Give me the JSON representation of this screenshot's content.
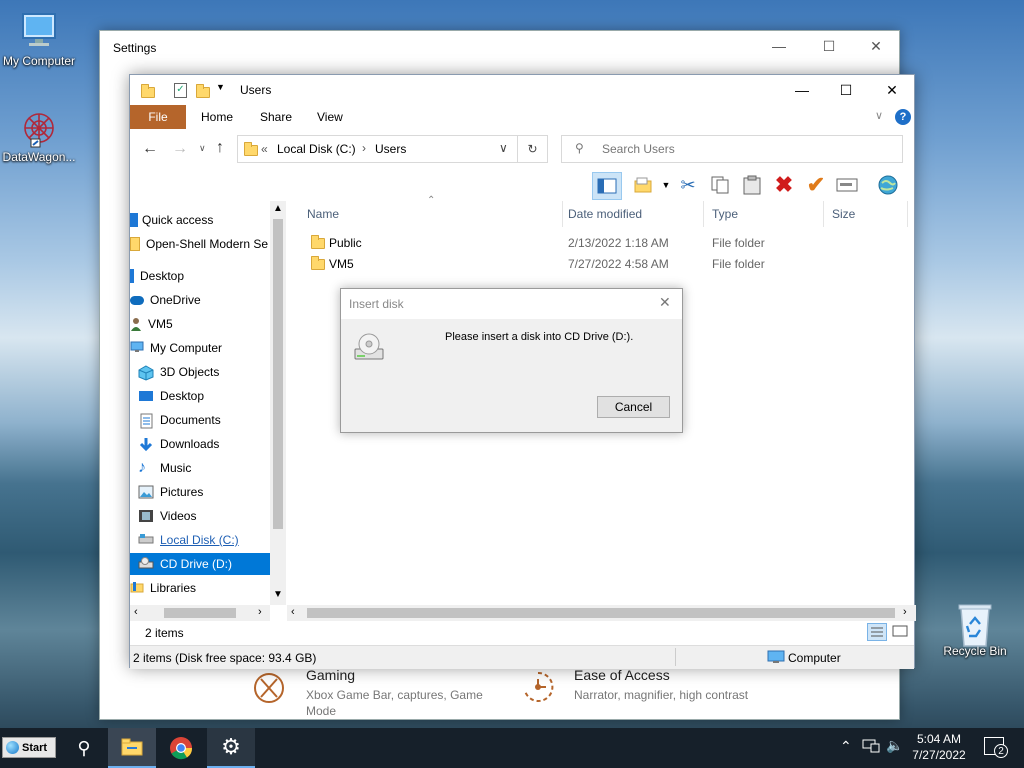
{
  "desktop": {
    "icons": [
      {
        "label": "My Computer",
        "icon": "monitor-icon"
      },
      {
        "label": "DataWagon...",
        "icon": "datawagon-icon"
      },
      {
        "label": "Recycle Bin",
        "icon": "recycle-bin-icon"
      }
    ]
  },
  "settings": {
    "title": "Settings",
    "categories": [
      {
        "title": "Gaming",
        "desc": "Xbox Game Bar, captures, Game Mode",
        "icon": "xbox-icon"
      },
      {
        "title": "Ease of Access",
        "desc": "Narrator, magnifier, high contrast",
        "icon": "ease-of-access-icon"
      }
    ]
  },
  "explorer": {
    "title": "Users",
    "tabs": {
      "file": "File",
      "home": "Home",
      "share": "Share",
      "view": "View"
    },
    "address": {
      "prefix": "«",
      "crumb1": "Local Disk (C:)",
      "crumb2": "Users"
    },
    "search_placeholder": "Search Users",
    "nav": [
      {
        "label": "Quick access",
        "icon": "star-icon"
      },
      {
        "label": "Open-Shell Modern Se",
        "icon": "folder-icon"
      },
      {
        "label": "Desktop",
        "icon": "desktop-icon"
      },
      {
        "label": "OneDrive",
        "icon": "cloud-icon"
      },
      {
        "label": "VM5",
        "icon": "user-icon"
      },
      {
        "label": "My Computer",
        "icon": "monitor-icon"
      },
      {
        "label": "3D Objects",
        "icon": "cube-icon"
      },
      {
        "label": "Desktop",
        "icon": "desktop-icon"
      },
      {
        "label": "Documents",
        "icon": "document-icon"
      },
      {
        "label": "Downloads",
        "icon": "download-icon"
      },
      {
        "label": "Music",
        "icon": "music-icon"
      },
      {
        "label": "Pictures",
        "icon": "picture-icon"
      },
      {
        "label": "Videos",
        "icon": "video-icon"
      },
      {
        "label": "Local Disk (C:)",
        "icon": "drive-icon"
      },
      {
        "label": "CD Drive (D:)",
        "icon": "cd-drive-icon"
      },
      {
        "label": "Libraries",
        "icon": "library-icon"
      }
    ],
    "columns": {
      "name": "Name",
      "date": "Date modified",
      "type": "Type",
      "size": "Size"
    },
    "files": [
      {
        "name": "Public",
        "date": "2/13/2022 1:18 AM",
        "type": "File folder"
      },
      {
        "name": "VM5",
        "date": "7/27/2022 4:58 AM",
        "type": "File folder"
      }
    ],
    "item_count": "2 items",
    "status_left": "2 items (Disk free space: 93.4 GB)",
    "status_right": "Computer"
  },
  "dialog": {
    "title": "Insert disk",
    "message": "Please insert a disk into CD Drive (D:).",
    "cancel": "Cancel"
  },
  "taskbar": {
    "start": "Start",
    "time": "5:04 AM",
    "date": "7/27/2022",
    "notifications": "2"
  },
  "colors": {
    "file_tab": "#b5652b",
    "selection": "#0078d7",
    "taskbar": "#16202a"
  }
}
